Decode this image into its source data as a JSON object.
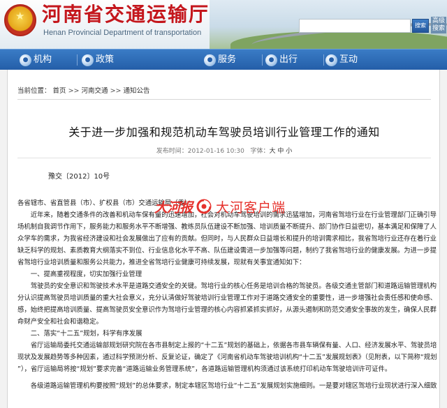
{
  "header": {
    "site_title": "河南省交通运输厅",
    "site_subtitle": "Henan Provincial Department of transportation",
    "search_placeholder": "",
    "search_button": "搜索",
    "adv_search": "高级搜索"
  },
  "nav": {
    "items": [
      {
        "label": "机构"
      },
      {
        "label": "政策"
      },
      {
        "label": "服务"
      },
      {
        "label": "出行"
      },
      {
        "label": "互动"
      }
    ]
  },
  "breadcrumb": {
    "prefix": "当前位置：",
    "items": [
      "首页",
      "河南交通",
      "通知公告"
    ],
    "sep": ">>"
  },
  "article": {
    "title": "关于进一步加强和规范机动车驾驶员培训行业管理工作的通知",
    "meta_label": "发布时间：",
    "meta_time": "2012-01-16 10:30",
    "font_label": "字体：",
    "font_sizes": [
      "大",
      "中",
      "小"
    ],
    "doc_no": "豫交〔2012〕10号",
    "lines": [
      "各省辖市、省直管县（市）、扩权县（市）交通运输局（委）：",
      "　　近年来，随着交通条件的改善和机动车保有量的迅速增加，社会对机动车驾驶培训的需求迅猛增加，河南省驾培行业在行业管理部门正确引导和市",
      "场机制自我调节作用下，服务能力和服务水平不断增强、教练员队伍建设不断加强、培训质量不断提升、部门协作日益密切，基本满足和保障了人民群",
      "众学车的需求，为我省经济建设和社会发展做出了应有的贡献。但同时，与人民群众日益增长和提升的培训需求相比，我省驾培行业还存在着行业发展",
      "缺乏科学的规划、素质教育大纲落实不到位、行业信息化水平不高、队伍建设需进一步加强等问题，制约了我省驾培行业的健康发展。为进一步提升我",
      "省驾培行业培训质量和服务公共能力，推进全省驾培行业健康可持续发展，现就有关事宜通知如下：",
      "　　一、提高重视程度，切实加强行业管理",
      "　　驾驶员的安全意识和驾驶技术水平是道路交通安全的关键。驾培行业的核心任务是培训合格的驾驶员。各级交通主管部门和道路运输管理机构要充",
      "分认识提高驾驶员培训质量的重大社会意义，充分认清做好驾驶培训行业管理工作对于道路交通安全的重要性，进一步增强社会责任感和使命感、紧迫",
      "感，始终把提高培训质量、提高驾驶员安全意识作为驾培行业管理的核心内容抓紧抓实抓好，从源头遏制和防范交通安全事故的发生，确保人民群众生",
      "命财产安全和社会和谐稳定。",
      "　　二、落实“十二五”规划，科学有序发展",
      "　　省厅运输局委托交通运输部规划研究院在各市县制定上报的“十二五”规划的基础上，依据各市县车辆保有量、人口、经济发展水平、驾驶员培训",
      "现状及发展趋势等多种因素，通过科学预测分析、反复论证，确定了《河南省机动车驾驶培训机构“十二五”发展规划表》（见附表，以下简称“规划",
      "”），省厅运输局将按“规划”要求完善“道路运输业务管理系统”，各道路运输管理机构须通过该系统打印机动车驾驶培训许可证件。",
      "　　各级道路运输管理机构要按照“规划”的总体要求，制定本辖区驾培行业“十二五”发展规划实施细则。一是要对辖区驾培行业现状进行深入细致"
    ]
  },
  "watermark": {
    "left": "大河报",
    "right": "大河客户端"
  },
  "colors": {
    "brand_red": "#c4161c",
    "nav_blue": "#245ea8",
    "watermark_red": "#e6322d"
  }
}
